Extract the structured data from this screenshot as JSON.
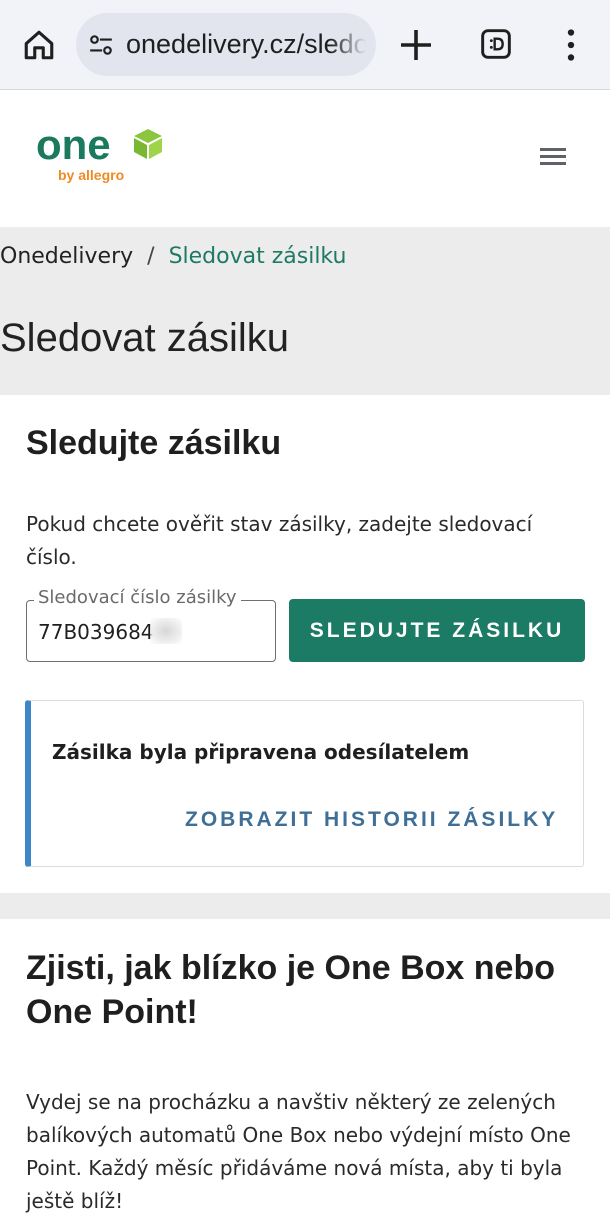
{
  "browser": {
    "url": "onedelivery.cz/sledovat-zasilku"
  },
  "site": {
    "logo_word": "one",
    "logo_sub": "by allegro"
  },
  "breadcrumb": {
    "home": "Onedelivery",
    "separator": "/",
    "current": "Sledovat zásilku"
  },
  "page_title": "Sledovat zásilku",
  "tracking": {
    "title": "Sledujte zásilku",
    "description": "Pokud chcete ověřit stav zásilky, zadejte sledovací číslo.",
    "field_label": "Sledovací číslo zásilky",
    "field_value": "77B039684",
    "button_label": "SLEDUJTE ZÁSILKU",
    "status_text": "Zásilka byla připravena odesílatelem",
    "history_link": "ZOBRAZIT HISTORII ZÁSILKY"
  },
  "section2": {
    "title": "Zjisti, jak blízko je One Box nebo One Point!",
    "text": "Vydej se na procházku a navštiv některý ze zelených balíkových automatů One Box nebo výdejní místo One Point. Každý měsíc přidáváme nová místa, aby ti byla ještě blíž!"
  },
  "colors": {
    "brand_green": "#1b7b64",
    "logo_green": "#1a7a5e",
    "logo_lime": "#8cc63f",
    "logo_orange": "#f08a24",
    "status_accent": "#3d87c9",
    "link_blue": "#3f6f96"
  },
  "icons": [
    "home-icon",
    "site-settings-icon",
    "new-tab-plus-icon",
    "tab-switcher-icon",
    "more-menu-icon",
    "hamburger-menu-icon",
    "cube-logo-icon"
  ]
}
